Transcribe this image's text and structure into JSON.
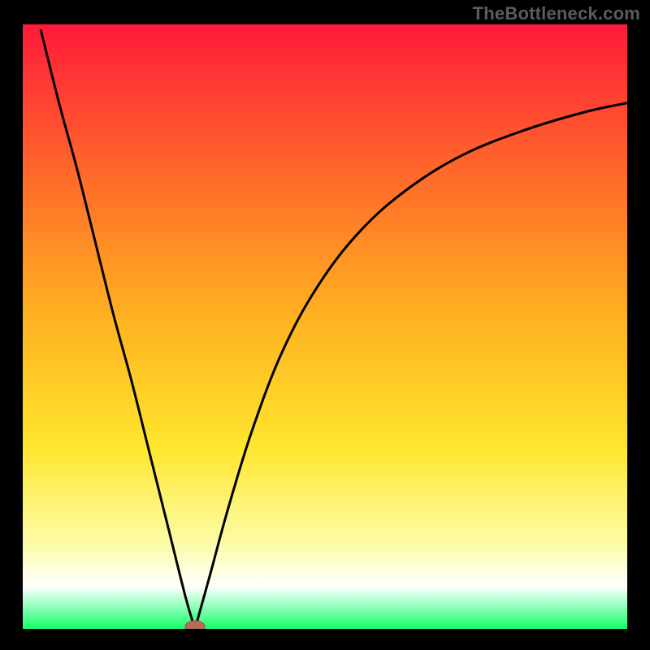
{
  "watermark": "TheBottleneck.com",
  "colors": {
    "frame": "#000000",
    "gradient_top": "#ff1a3a",
    "gradient_mid_upper": "#ff6a2a",
    "gradient_mid": "#ffb020",
    "gradient_mid_lower": "#ffe62e",
    "gradient_pale": "#fcfca8",
    "gradient_white": "#ffffff",
    "gradient_bottom": "#16ff6a",
    "curve": "#000000",
    "marker_fill": "#b96a5b",
    "marker_stroke": "#a05045"
  },
  "chart_data": {
    "type": "line",
    "title": "",
    "xlabel": "",
    "ylabel": "",
    "xlim": [
      0,
      100
    ],
    "ylim": [
      0,
      100
    ],
    "series": [
      {
        "name": "bottleneck-curve-left",
        "x": [
          3,
          6,
          9,
          12,
          15,
          18,
          21,
          24,
          27,
          28.5
        ],
        "y": [
          99,
          87,
          76,
          64,
          52,
          41,
          29,
          17,
          5,
          0
        ]
      },
      {
        "name": "bottleneck-curve-right",
        "x": [
          28.5,
          31,
          34,
          38,
          43,
          49,
          56,
          64,
          73,
          83,
          93,
          100
        ],
        "y": [
          0,
          9,
          20,
          33,
          46,
          57,
          66,
          73,
          78.5,
          82.5,
          85.5,
          87
        ]
      }
    ],
    "marker": {
      "x": 28.5,
      "y": 0
    },
    "annotations": []
  }
}
